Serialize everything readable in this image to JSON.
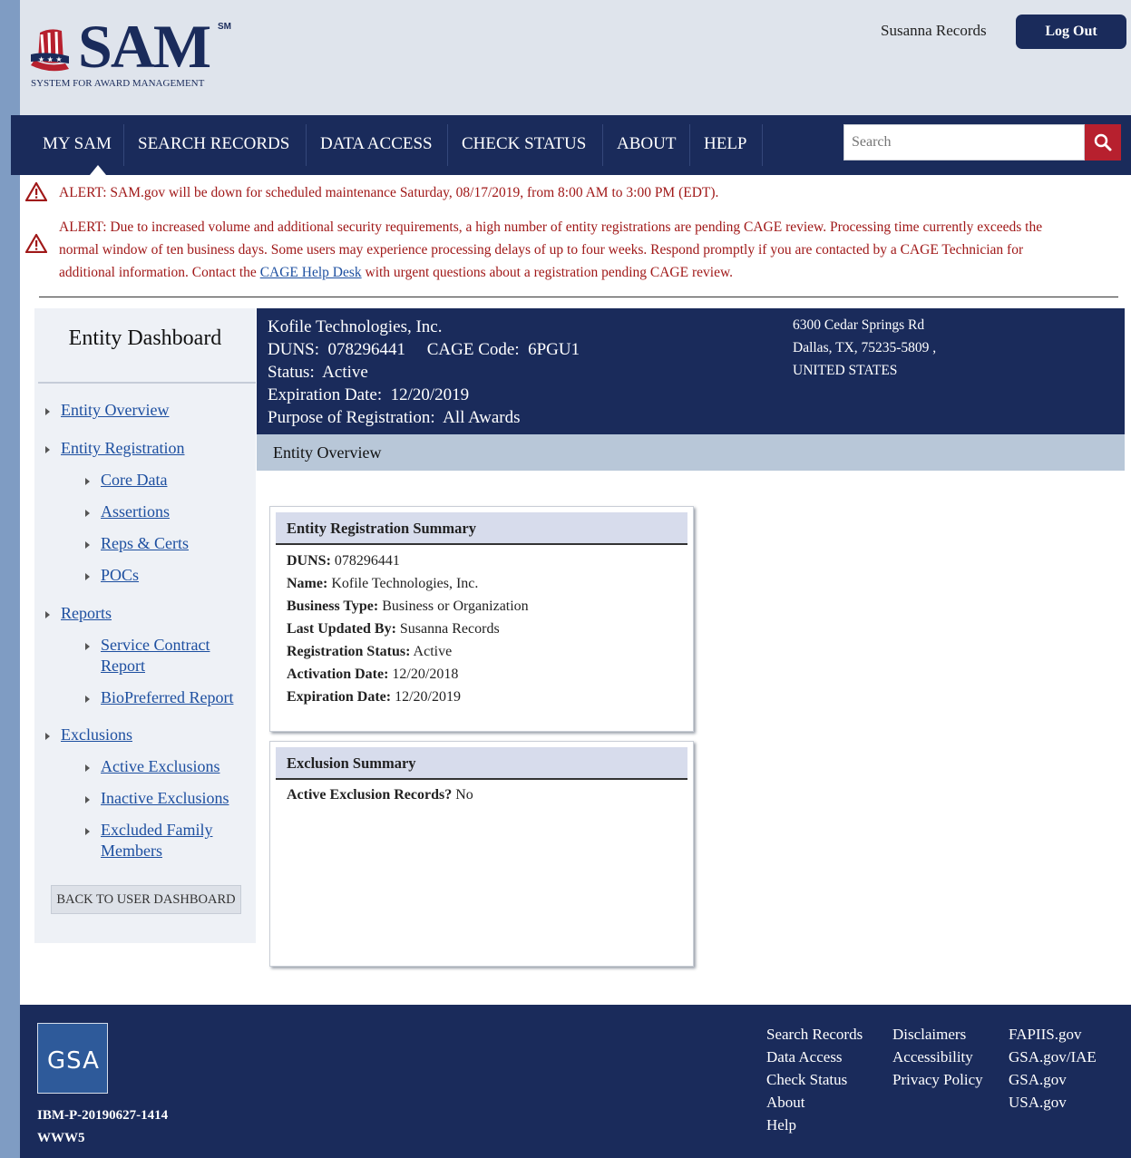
{
  "header": {
    "logo_text": "SAM",
    "logo_sm": "SM",
    "logo_subtitle": "SYSTEM FOR AWARD MANAGEMENT",
    "user_name": "Susanna Records",
    "logout_label": "Log Out"
  },
  "nav": {
    "items": [
      "MY SAM",
      "SEARCH RECORDS",
      "DATA ACCESS",
      "CHECK STATUS",
      "ABOUT",
      "HELP"
    ],
    "search_placeholder": "Search"
  },
  "alerts": {
    "first": "ALERT: SAM.gov will be down for scheduled maintenance Saturday, 08/17/2019, from 8:00 AM to 3:00 PM (EDT).",
    "second_line1": "ALERT: Due to increased volume and additional security requirements, a high number of entity registrations are pending CAGE review. Processing time currently exceeds the",
    "second_line2": "normal window of ten business days. Some users may experience processing delays of up to four weeks. Respond promptly if you are contacted by a CAGE Technician for",
    "second_line3_pre": "additional information. Contact the ",
    "second_link": "CAGE Help Desk",
    "second_line3_post": " with urgent questions about a registration pending CAGE review."
  },
  "sidebar": {
    "title": "Entity Dashboard",
    "entity_overview": "Entity Overview",
    "entity_registration": "Entity Registration",
    "core_data": "Core Data",
    "assertions": "Assertions",
    "reps_certs": "Reps & Certs",
    "pocs": "POCs",
    "reports": "Reports",
    "service_contract_1": "Service Contract",
    "service_contract_2": "Report",
    "biopreferred": "BioPreferred Report",
    "exclusions": "Exclusions",
    "active_exclusions": "Active Exclusions",
    "inactive_exclusions": "Inactive Exclusions",
    "excluded_family_1": "Excluded Family",
    "excluded_family_2": "Members",
    "back_button": "BACK TO USER DASHBOARD"
  },
  "entity": {
    "name": "Kofile Technologies, Inc.",
    "duns_line": "DUNS:  078296441     CAGE Code:  6PGU1",
    "status_line": "Status:  Active",
    "expiration_line": "Expiration Date:  12/20/2019",
    "purpose_line": "Purpose of Registration:  All Awards",
    "address1": "6300 Cedar Springs Rd",
    "address2": "Dallas, TX, 75235-5809 ,",
    "address3": "UNITED STATES",
    "section_title": "Entity Overview"
  },
  "registration_summary": {
    "title": "Entity Registration Summary",
    "duns_label": "DUNS:",
    "duns_value": " 078296441",
    "name_label": "Name:",
    "name_value": " Kofile Technologies, Inc.",
    "business_type_label": "Business Type:",
    "business_type_value": " Business or Organization",
    "last_updated_label": "Last Updated By:",
    "last_updated_value": " Susanna Records",
    "reg_status_label": "Registration Status:",
    "reg_status_value": " Active",
    "activation_label": "Activation Date:",
    "activation_value": " 12/20/2018",
    "expiration_label": "Expiration Date:",
    "expiration_value": " 12/20/2019"
  },
  "exclusion_summary": {
    "title": "Exclusion Summary",
    "active_label": "Active Exclusion Records?",
    "active_value": " No"
  },
  "footer": {
    "gsa_logo": "GSA",
    "build_code": "IBM-P-20190627-1414",
    "server": "WWW5",
    "col1": [
      "Search Records",
      "Data Access",
      "Check Status",
      "About",
      "Help"
    ],
    "col2": [
      "Disclaimers",
      "Accessibility",
      "Privacy Policy"
    ],
    "col3": [
      "FAPIIS.gov",
      "GSA.gov/IAE",
      "GSA.gov",
      "USA.gov"
    ]
  },
  "colors": {
    "navy": "#1a2b5b",
    "alert_red": "#a01818",
    "link_blue": "#1d4fa0",
    "search_red": "#b7202e"
  }
}
